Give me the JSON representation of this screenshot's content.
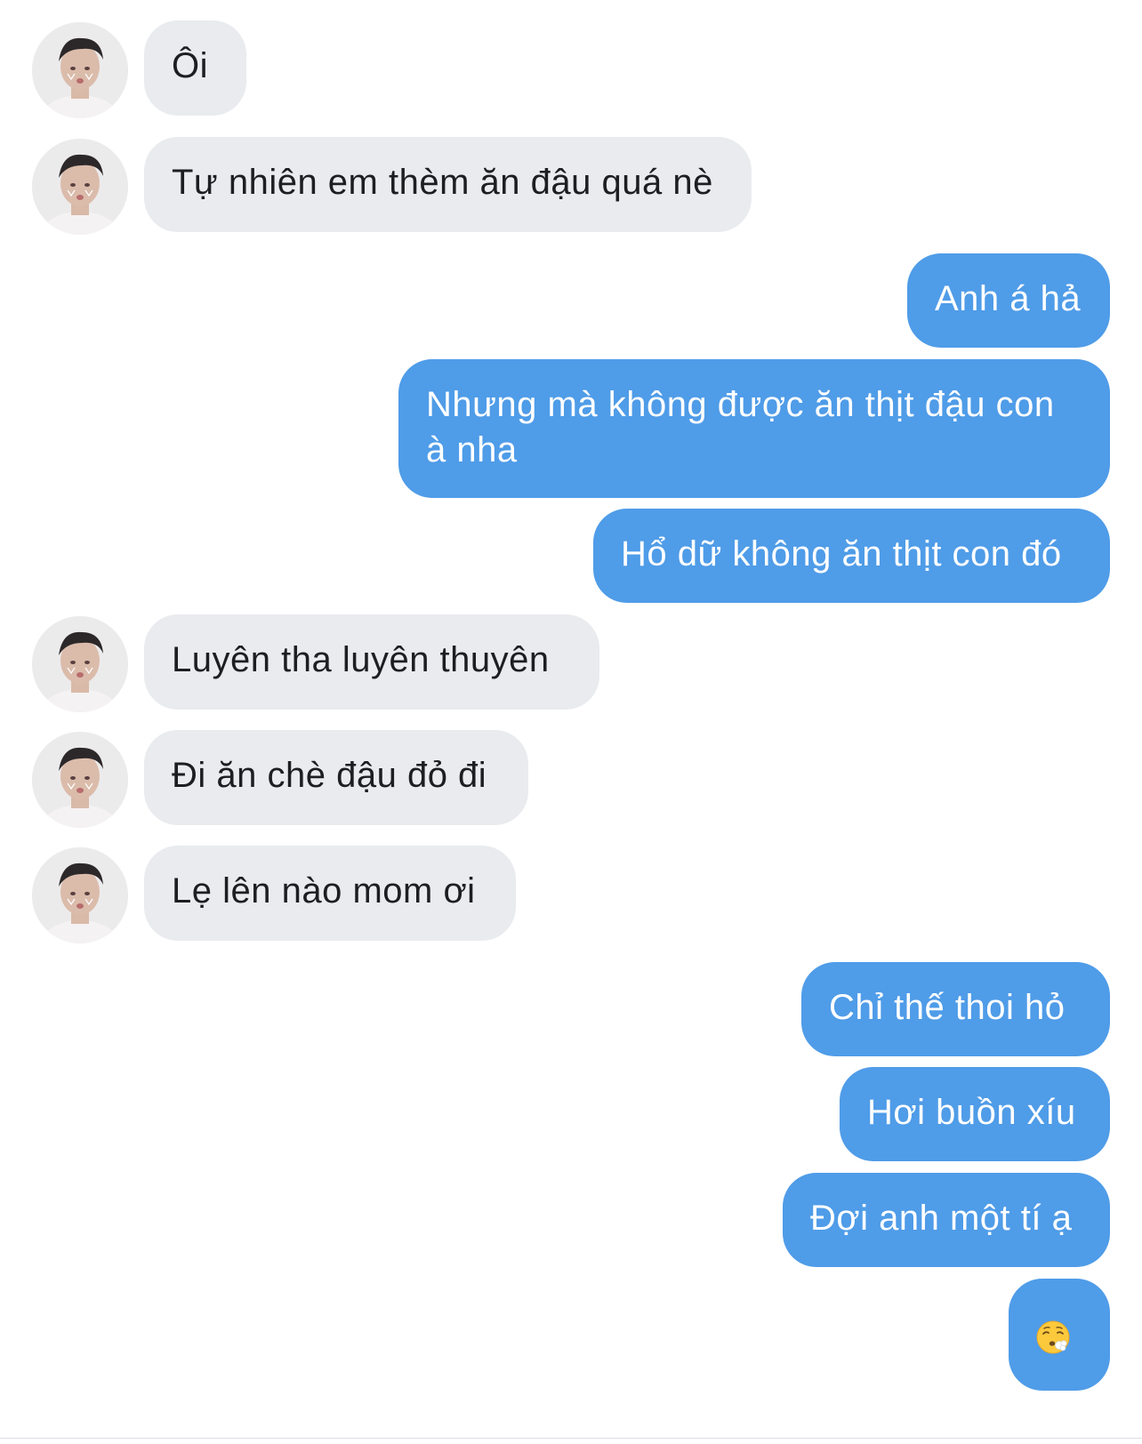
{
  "conversation": {
    "messages": [
      {
        "sender": "them",
        "text": "Ôi"
      },
      {
        "sender": "them",
        "text": "Tự nhiên em thèm ăn đậu quá nè"
      },
      {
        "sender": "me",
        "text": "Anh á hả"
      },
      {
        "sender": "me",
        "text": "Nhưng mà không được ăn thịt đậu con à nha"
      },
      {
        "sender": "me",
        "text": "Hổ dữ không ăn thịt con đó"
      },
      {
        "sender": "them",
        "text": "Luyên tha luyên thuyên"
      },
      {
        "sender": "them",
        "text": "Đi ăn chè đậu đỏ đi"
      },
      {
        "sender": "them",
        "text": "Lẹ lên nào mom ơi"
      },
      {
        "sender": "me",
        "text": "Chỉ thế thoi hỏ"
      },
      {
        "sender": "me",
        "text": "Hơi buồn xíu"
      },
      {
        "sender": "me",
        "text": "Đợi anh một tí ạ"
      },
      {
        "sender": "me",
        "text": "",
        "emoji": "face-exhaling-emoji"
      }
    ]
  },
  "theme": {
    "incoming_bubble": "#e9ebee",
    "outgoing_bubble": "#4f9ce8",
    "incoming_text": "#1c1e21",
    "outgoing_text": "#ffffff",
    "avatar_icon": "user-photo-avatar"
  }
}
